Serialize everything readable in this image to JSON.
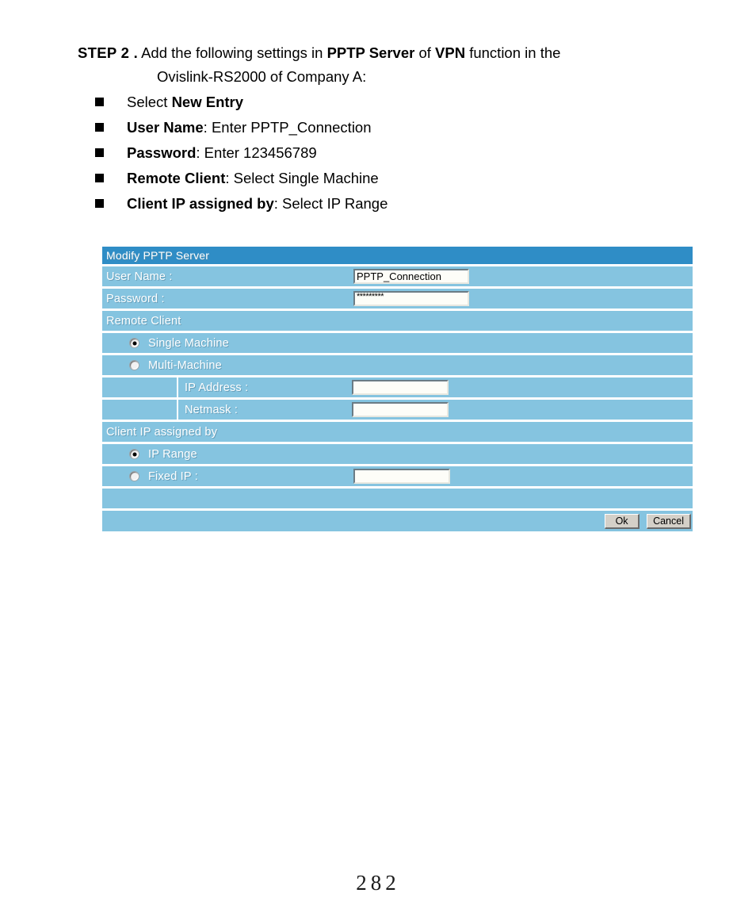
{
  "step": {
    "label": "STEP 2 .",
    "text_before_1": "Add the following settings in ",
    "bold_1": "PPTP Server",
    "text_mid_1": " of ",
    "bold_2": "VPN",
    "text_after_1": " function in the",
    "line2": "Ovislink-RS2000 of Company A:"
  },
  "bullets": [
    {
      "normal_prefix": "Select ",
      "bold": "New Entry",
      "normal_suffix": ""
    },
    {
      "normal_prefix": "",
      "bold": "User Name",
      "normal_suffix": ": Enter PPTP_Connection"
    },
    {
      "normal_prefix": "",
      "bold": "Password",
      "normal_suffix": ": Enter 123456789"
    },
    {
      "normal_prefix": "",
      "bold": "Remote Client",
      "normal_suffix": ": Select Single Machine"
    },
    {
      "normal_prefix": "",
      "bold": "Client IP assigned by",
      "normal_suffix": ": Select IP Range"
    }
  ],
  "panel": {
    "title": "Modify PPTP Server",
    "user_name_label": "User Name  :",
    "user_name_value": "PPTP_Connection",
    "password_label": "Password  :",
    "password_value": "*********",
    "remote_client_label": "Remote Client",
    "single_machine_label": "Single Machine",
    "single_machine_selected": true,
    "multi_machine_label": "Multi-Machine",
    "multi_machine_selected": false,
    "ip_address_label": "IP Address :",
    "ip_address_value": "",
    "netmask_label": "Netmask :",
    "netmask_value": "",
    "client_ip_label": "Client IP assigned by",
    "ip_range_label": "IP Range",
    "ip_range_selected": true,
    "fixed_ip_label": "Fixed IP :",
    "fixed_ip_selected": false,
    "fixed_ip_value": "",
    "ok_label": "Ok",
    "cancel_label": "Cancel",
    "colors": {
      "header_blue": "#2f8dc6",
      "row_blue": "#85c4e0",
      "label_white": "#ffffff",
      "button_face": "#d4d0c8"
    }
  },
  "page_number": "282"
}
